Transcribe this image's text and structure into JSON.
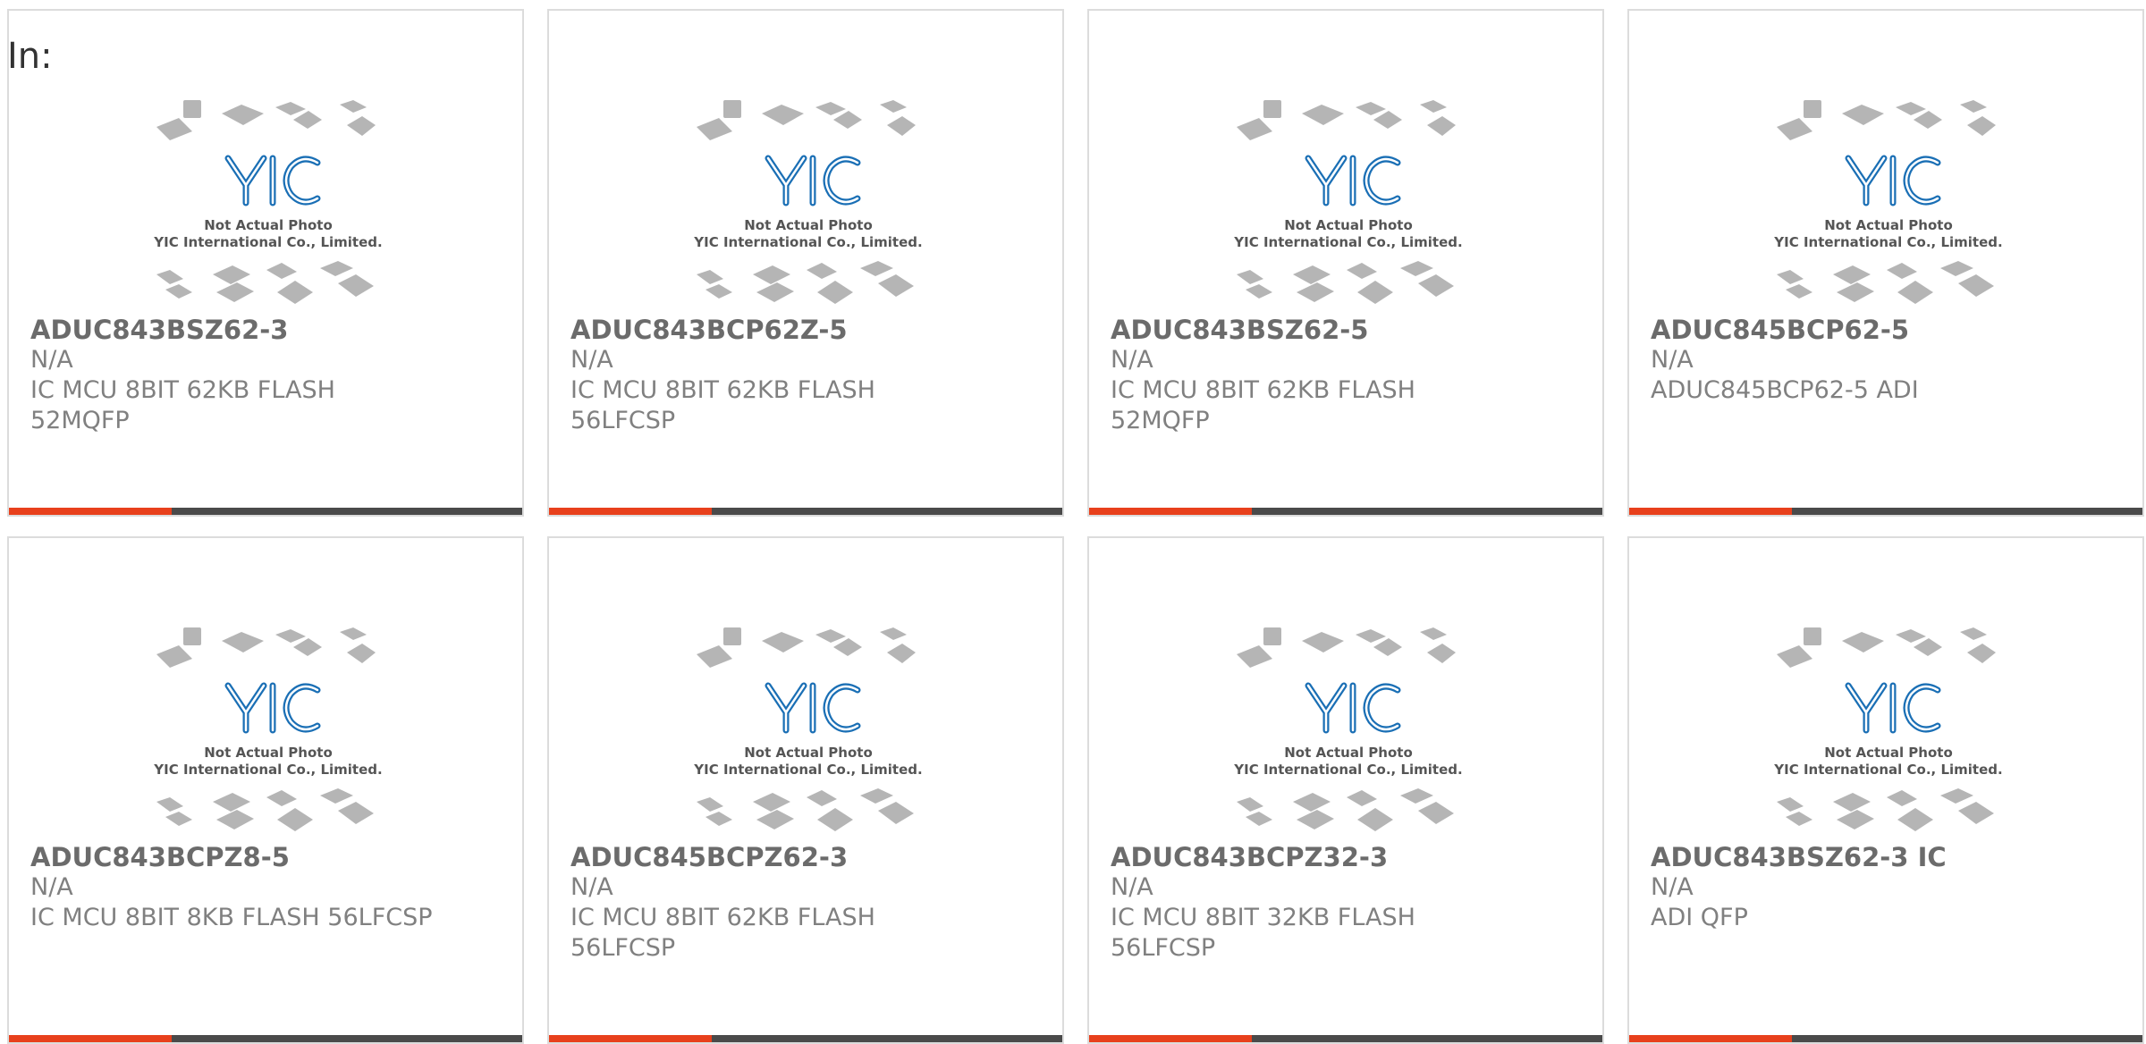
{
  "page": {
    "in_label": "In:"
  },
  "photo": {
    "brand": "YIC",
    "caption1": "Not Actual Photo",
    "caption2": "YIC International Co., Limited."
  },
  "colors": {
    "accent": "#e8401c",
    "bar": "#4a4a4a",
    "logo_blue": "#1a6fb5"
  },
  "products": [
    {
      "name": "ADUC843BSZ62-3",
      "stock": "N/A",
      "desc1": "IC MCU 8BIT 62KB FLASH",
      "desc2": "52MQFP"
    },
    {
      "name": "ADUC843BCP62Z-5",
      "stock": "N/A",
      "desc1": "IC MCU 8BIT 62KB FLASH",
      "desc2": "56LFCSP"
    },
    {
      "name": "ADUC843BSZ62-5",
      "stock": "N/A",
      "desc1": "IC MCU 8BIT 62KB FLASH",
      "desc2": "52MQFP"
    },
    {
      "name": "ADUC845BCP62-5",
      "stock": "N/A",
      "desc1": "ADUC845BCP62-5 ADI",
      "desc2": ""
    },
    {
      "name": "ADUC843BCPZ8-5",
      "stock": "N/A",
      "desc1": "IC MCU 8BIT 8KB FLASH 56LFCSP",
      "desc2": ""
    },
    {
      "name": "ADUC845BCPZ62-3",
      "stock": "N/A",
      "desc1": "IC MCU 8BIT 62KB FLASH",
      "desc2": "56LFCSP"
    },
    {
      "name": "ADUC843BCPZ32-3",
      "stock": "N/A",
      "desc1": "IC MCU 8BIT 32KB FLASH",
      "desc2": "56LFCSP"
    },
    {
      "name": "ADUC843BSZ62-3 IC",
      "stock": "N/A",
      "desc1": "ADI QFP",
      "desc2": ""
    }
  ]
}
